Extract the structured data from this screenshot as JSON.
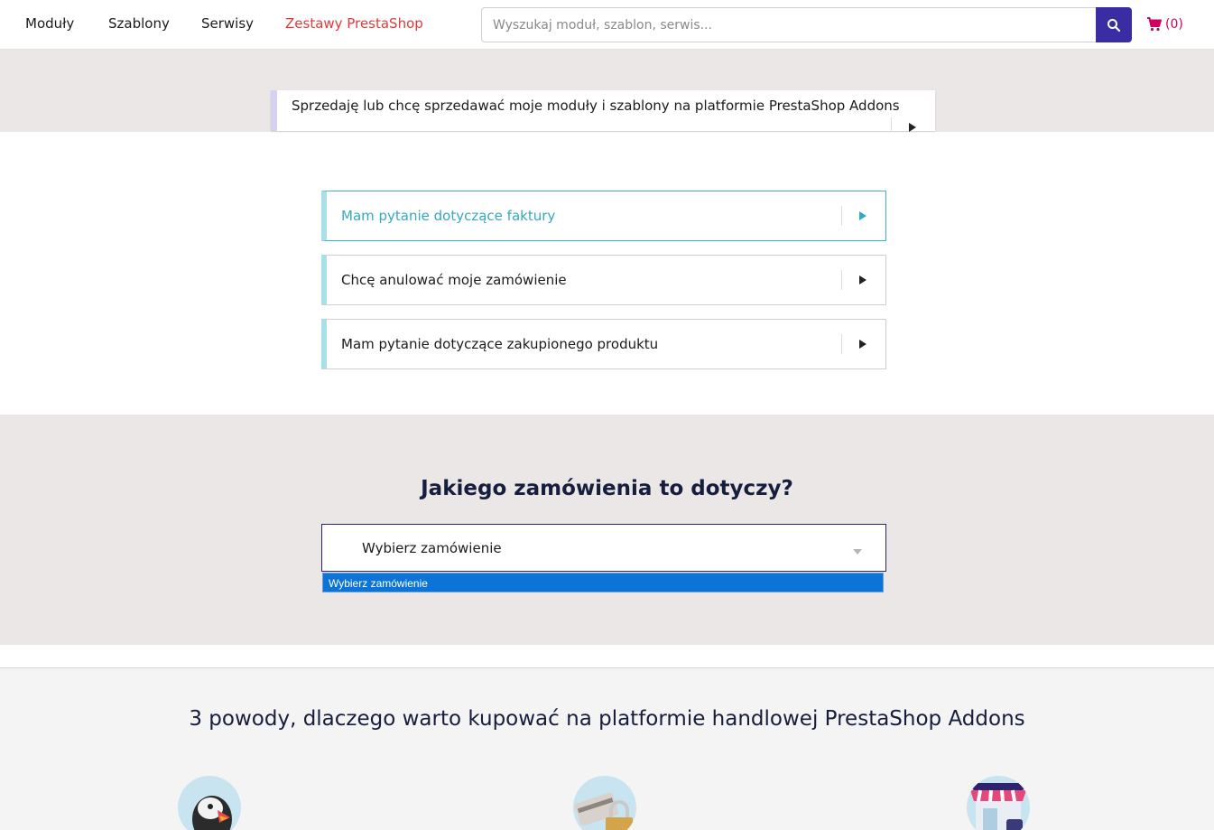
{
  "header": {
    "nav": [
      "Moduły",
      "Szablony",
      "Serwisy",
      "Zestawy PrestaShop"
    ],
    "search_placeholder": "Wyszukaj moduł, szablon, serwis...",
    "cart_count": "(0)"
  },
  "seller_card": {
    "label": "Sprzedaję lub chcę sprzedawać moje moduły i szablony na platformie PrestaShop Addons"
  },
  "questions": [
    "Mam pytanie dotyczące faktury",
    "Chcę anulować moje zamówienie",
    "Mam pytanie dotyczące zakupionego produktu"
  ],
  "order_section": {
    "title": "Jakiego zamówienia to dotyczy?",
    "select_value": "Wybierz zamówienie",
    "dropdown_option": "Wybierz zamówienie"
  },
  "reasons": {
    "title": "3 powody, dlaczego warto kupować na platformie handlowej PrestaShop Addons",
    "icons": [
      "puffin-icon",
      "secure-payment-icon",
      "marketplace-icon"
    ]
  },
  "colors": {
    "accent": "#3a2ca3",
    "cart": "#d4005f",
    "highlight": "#37a8c2",
    "nav_red": "#e03a3a",
    "dropdown_blue": "#0b74d6"
  }
}
